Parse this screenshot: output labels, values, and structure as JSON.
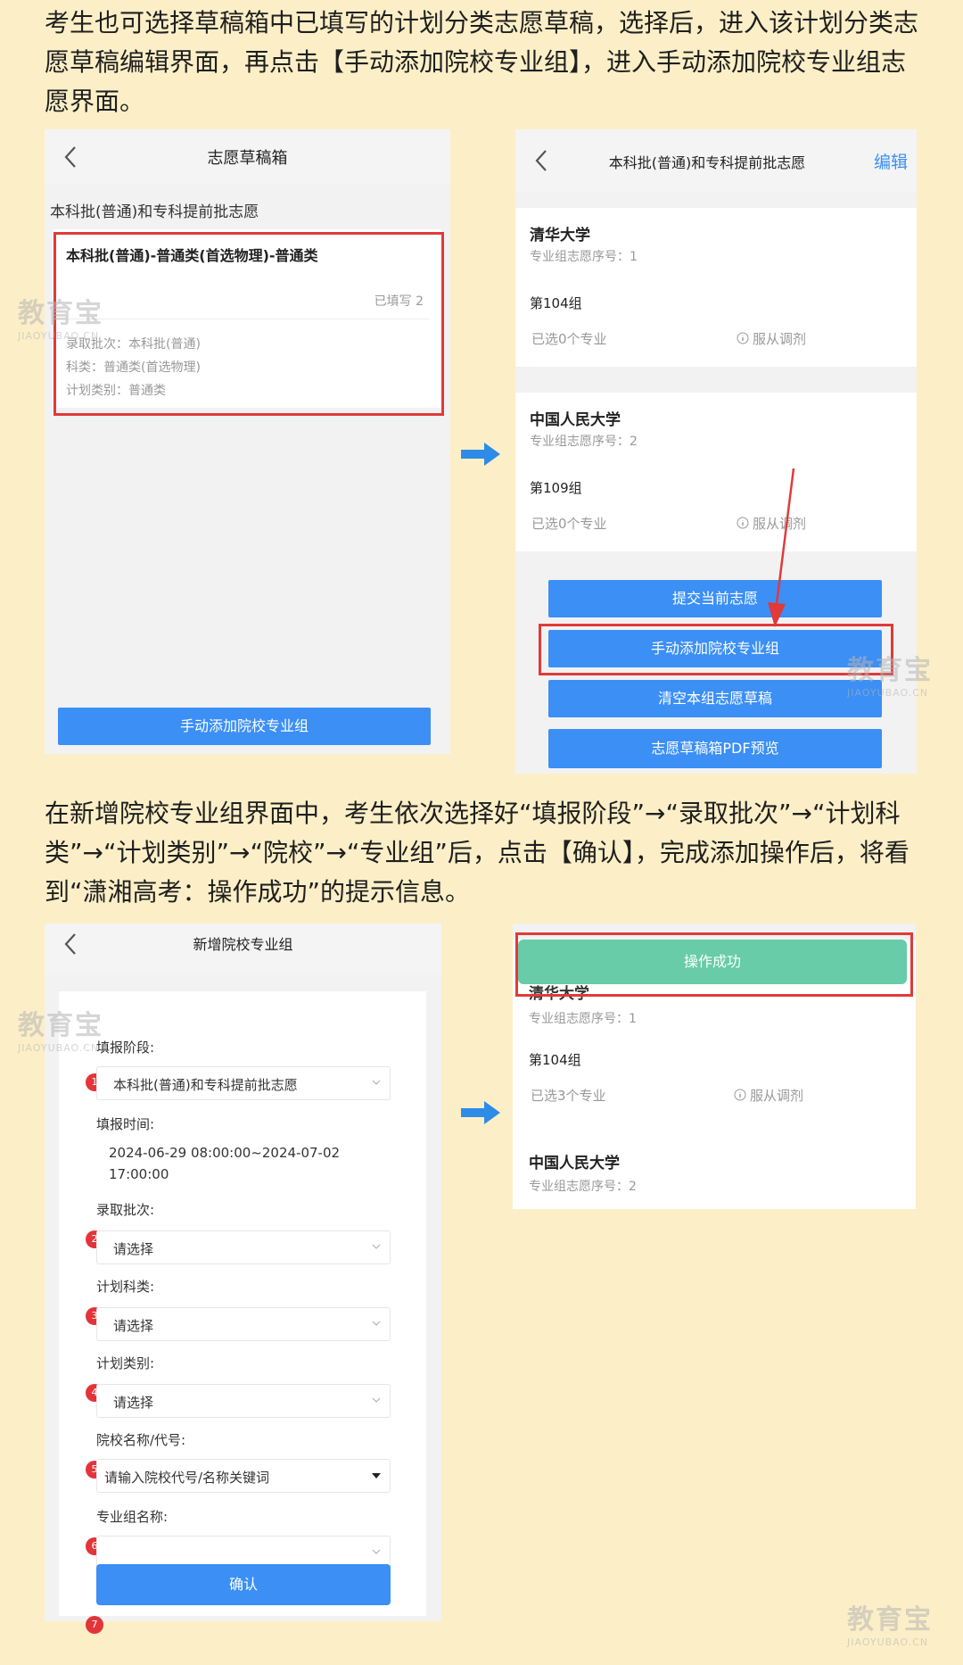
{
  "intro_text": "考生也可选择草稿箱中已填写的计划分类志愿草稿，选择后，进入该计划分类志愿草稿编辑界面，再点击【手动添加院校专业组】，进入手动添加院校专业组志愿界面。",
  "middle_text": "在新增院校专业组界面中，考生依次选择好“填报阶段”→“录取批次”→“计划科类”→“计划类别”→“院校”→“专业组”后，点击【确认】，完成添加操作后，将看到“潇湘高考：操作成功”的提示信息。",
  "screen1": {
    "title": "志愿草稿箱",
    "section": "本科批(普通)和专科提前批志愿",
    "card_title": "本科批(普通)-普通类(首选物理)-普通类",
    "filled": "已填写 2",
    "batch": "录取批次：本科批(普通)",
    "subject": "科类：普通类(首选物理)",
    "plan_type": "计划类别：普通类",
    "add_button": "手动添加院校专业组"
  },
  "screen2": {
    "title": "本科批(普通)和专科提前批志愿",
    "edit": "编辑",
    "schools": [
      {
        "name": "清华大学",
        "order": "专业组志愿序号：1",
        "group": "第104组",
        "selected": "已选0个专业",
        "adjust": "服从调剂"
      },
      {
        "name": "中国人民大学",
        "order": "专业组志愿序号：2",
        "group": "第109组",
        "selected": "已选0个专业",
        "adjust": "服从调剂"
      }
    ],
    "buttons": [
      "提交当前志愿",
      "手动添加院校专业组",
      "清空本组志愿草稿",
      "志愿草稿箱PDF预览"
    ]
  },
  "screen3": {
    "title": "新增院校专业组",
    "stage_label": "填报阶段:",
    "stage_value": "本科批(普通)和专科提前批志愿",
    "time_label": "填报时间:",
    "time_value_1": "2024-06-29 08:00:00~2024-07-02",
    "time_value_2": "17:00:00",
    "batch_label": "录取批次:",
    "subject_label": "计划科类:",
    "type_label": "计划类别:",
    "placeholder_select": "请选择",
    "school_label": "院校名称/代号:",
    "school_placeholder": "请输入院校代号/名称关键词",
    "group_label": "专业组名称:",
    "confirm": "确认",
    "numbers": [
      "1",
      "2",
      "3",
      "4",
      "5",
      "6",
      "7"
    ]
  },
  "screen4": {
    "toast": "操作成功",
    "schools": [
      {
        "name": "清华大学",
        "order": "专业组志愿序号：1",
        "group": "第104组",
        "selected": "已选3个专业",
        "adjust": "服从调剂"
      },
      {
        "name": "中国人民大学",
        "order": "专业组志愿序号：2"
      }
    ]
  },
  "watermark": {
    "big": "教育宝",
    "small": "JIAOYUBAO.CN"
  },
  "colors": {
    "background": "#fcefc7",
    "button_blue": "#3b8ff5",
    "highlight_red": "#e03a3a",
    "toast_green": "#5ac8a0"
  }
}
